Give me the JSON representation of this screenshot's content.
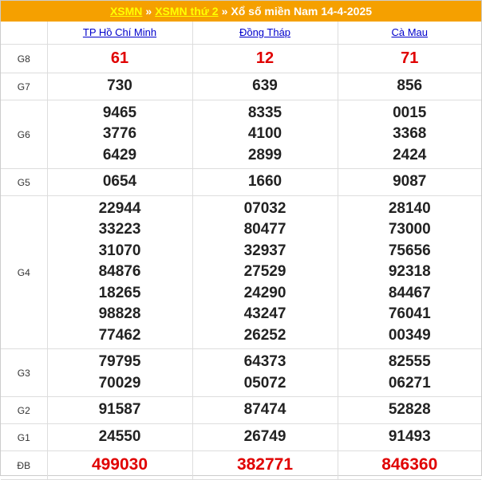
{
  "header": {
    "link1": "XSMN",
    "sep1": "»",
    "link2": "XSMN thứ 2",
    "sep2": "»",
    "title": "Xổ số miền Nam 14-4-2025"
  },
  "provinces": [
    "TP Hồ Chí Minh",
    "Đồng Tháp",
    "Cà Mau"
  ],
  "prizes": [
    {
      "label": "G8",
      "values": [
        [
          "61"
        ],
        [
          "12"
        ],
        [
          "71"
        ]
      ]
    },
    {
      "label": "G7",
      "values": [
        [
          "730"
        ],
        [
          "639"
        ],
        [
          "856"
        ]
      ]
    },
    {
      "label": "G6",
      "values": [
        [
          "9465",
          "3776",
          "6429"
        ],
        [
          "8335",
          "4100",
          "2899"
        ],
        [
          "0015",
          "3368",
          "2424"
        ]
      ]
    },
    {
      "label": "G5",
      "values": [
        [
          "0654"
        ],
        [
          "1660"
        ],
        [
          "9087"
        ]
      ]
    },
    {
      "label": "G4",
      "values": [
        [
          "22944",
          "33223",
          "31070",
          "84876",
          "18265",
          "98828",
          "77462"
        ],
        [
          "07032",
          "80477",
          "32937",
          "27529",
          "24290",
          "43247",
          "26252"
        ],
        [
          "28140",
          "73000",
          "75656",
          "92318",
          "84467",
          "76041",
          "00349"
        ]
      ]
    },
    {
      "label": "G3",
      "values": [
        [
          "79795",
          "70029"
        ],
        [
          "64373",
          "05072"
        ],
        [
          "82555",
          "06271"
        ]
      ]
    },
    {
      "label": "G2",
      "values": [
        [
          "91587"
        ],
        [
          "87474"
        ],
        [
          "52828"
        ]
      ]
    },
    {
      "label": "G1",
      "values": [
        [
          "24550"
        ],
        [
          "26749"
        ],
        [
          "91493"
        ]
      ]
    },
    {
      "label": "ĐB",
      "values": [
        [
          "499030"
        ],
        [
          "382771"
        ],
        [
          "846360"
        ]
      ]
    }
  ],
  "colors": {
    "topbar": "#f5a000",
    "link": "#0000cc",
    "special": "#e00000"
  }
}
